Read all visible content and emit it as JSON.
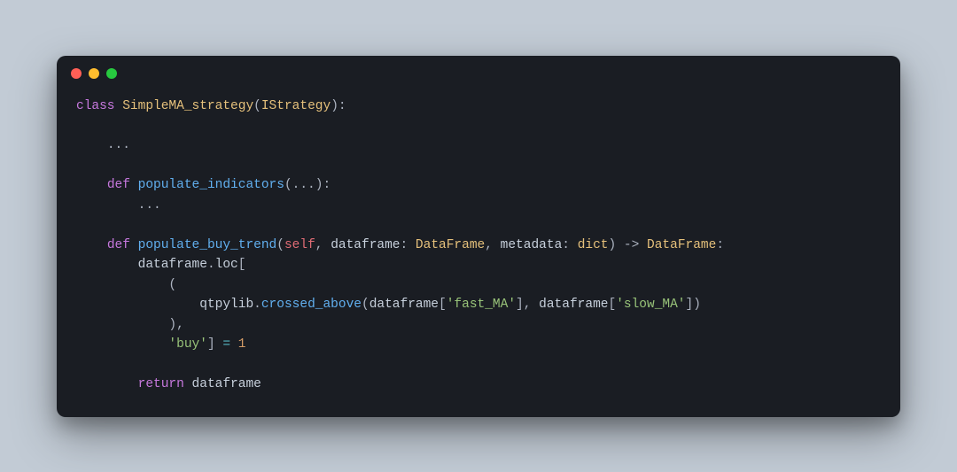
{
  "code": {
    "kw_class": "class",
    "class_name": "SimpleMA_strategy",
    "base_class": "IStrategy",
    "dots1": "...",
    "kw_def1": "def",
    "fn_indicators": "populate_indicators",
    "params_ind": "...",
    "dots2": "...",
    "kw_def2": "def",
    "fn_buy": "populate_buy_trend",
    "self": "self",
    "p_dataframe": "dataframe",
    "t_DataFrame": "DataFrame",
    "p_metadata": "metadata",
    "t_dict": "dict",
    "arrow": "->",
    "ret_type": "DataFrame",
    "df_var": "dataframe",
    "loc_attr": "loc",
    "qtpylib": "qtpylib",
    "crossed_above": "crossed_above",
    "str_fast": "'fast_MA'",
    "str_slow": "'slow_MA'",
    "str_buy": "'buy'",
    "assign": "=",
    "val_one": "1",
    "kw_return": "return",
    "ret_var": "dataframe",
    "paren_open": "(",
    "paren_close": ")",
    "bracket_open": "[",
    "bracket_close": "]",
    "colon": ":",
    "comma": ","
  }
}
